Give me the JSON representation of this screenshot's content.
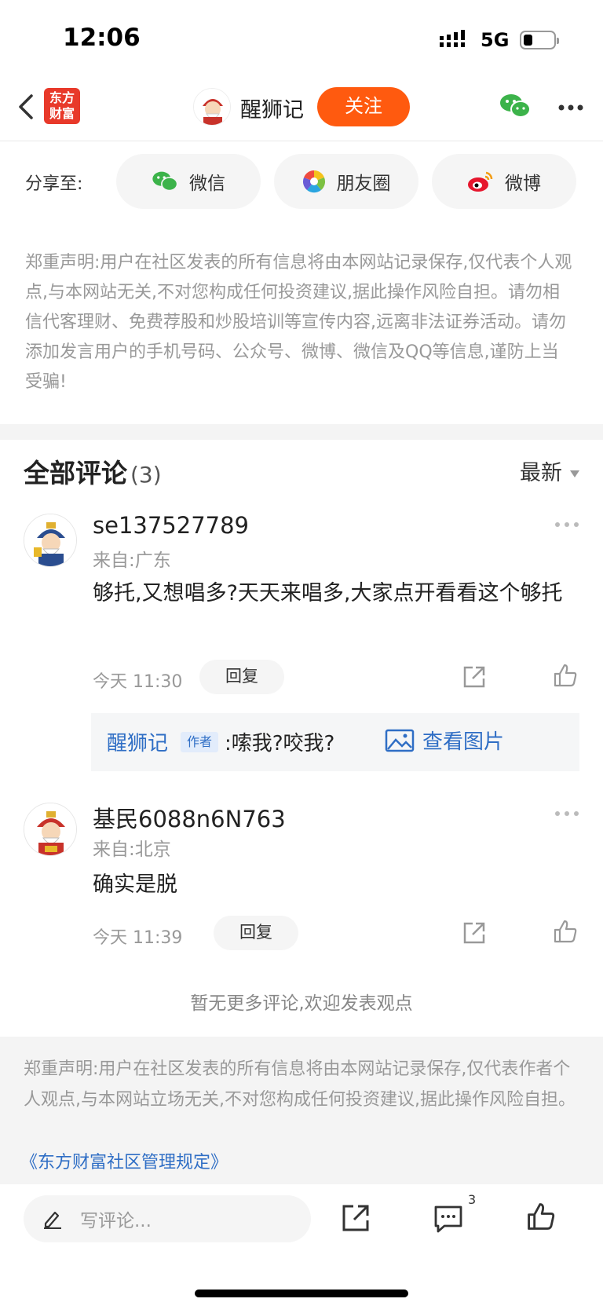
{
  "status": {
    "time": "12:06",
    "network": "5G",
    "battery_level": 0.3
  },
  "nav": {
    "logo_text_1": "东方",
    "logo_text_2": "财富",
    "author_name": "醒狮记",
    "follow_label": "关注",
    "back_icon": "chevron-left-icon",
    "wechat_icon": "wechat-icon",
    "more_icon": "more-horizontal-icon"
  },
  "share": {
    "label": "分享至:",
    "options": [
      {
        "label": "微信",
        "icon": "wechat-icon"
      },
      {
        "label": "朋友圈",
        "icon": "moments-icon"
      },
      {
        "label": "微博",
        "icon": "weibo-icon"
      }
    ]
  },
  "disclaimer_top": "郑重声明:用户在社区发表的所有信息将由本网站记录保存,仅代表个人观点,与本网站无关,不对您构成任何投资建议,据此操作风险自担。请勿相信代客理财、免费荐股和炒股培训等宣传内容,远离非法证券活动。请勿添加发言用户的手机号码、公众号、微博、微信及QQ等信息,谨防上当受骗!",
  "comments_header": {
    "title": "全部评论",
    "count": "(3)",
    "sort_label": "最新"
  },
  "comments": [
    {
      "user": "se137527789",
      "location": "来自:广东",
      "text": "够托,又想唱多?天天来唱多,大家点开看看这个够托",
      "time": "今天 11:30",
      "reply_label": "回复",
      "author_reply": {
        "name": "醒狮记",
        "badge": "作者",
        "text": ":嗦我?咬我?",
        "link_label": "查看图片"
      }
    },
    {
      "user": "基民6088n6N763",
      "location": "来自:北京",
      "text": "确实是脱",
      "time": "今天 11:39",
      "reply_label": "回复"
    }
  ],
  "no_more": "暂无更多评论,欢迎发表观点",
  "disclaimer_bottom": "郑重声明:用户在社区发表的所有信息将由本网站记录保存,仅代表作者个人观点,与本网站立场无关,不对您构成任何投资建议,据此操作风险自担。",
  "rules_link": "《东方财富社区管理规定》",
  "bottom_bar": {
    "input_placeholder": "写评论...",
    "comment_count": "3"
  },
  "colors": {
    "accent": "#ff5a0f",
    "link": "#2f6ec5",
    "brand": "#e8392a"
  }
}
